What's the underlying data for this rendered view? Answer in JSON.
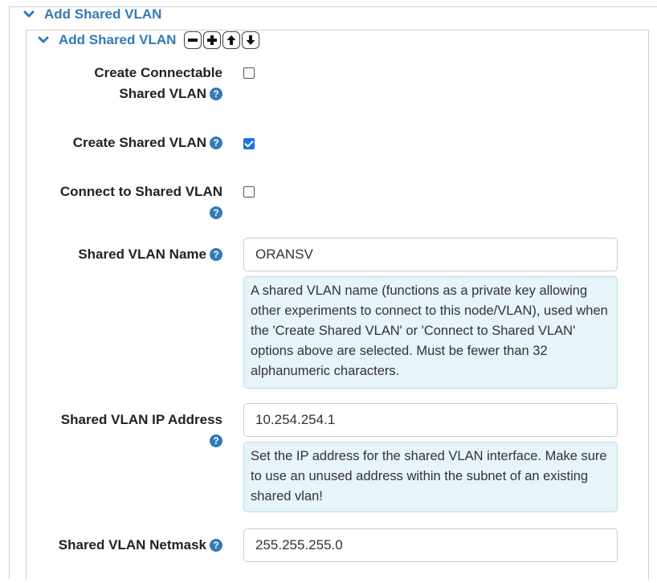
{
  "outer_section": {
    "title": "Add Shared VLAN"
  },
  "inner_section": {
    "title": "Add Shared VLAN"
  },
  "fields": {
    "create_connectable": {
      "label_line1": "Create Connectable",
      "label_line2": "Shared VLAN",
      "checked": false
    },
    "create_shared": {
      "label": "Create Shared VLAN",
      "checked": true
    },
    "connect_to_shared": {
      "label": "Connect to Shared VLAN",
      "checked": false
    },
    "shared_vlan_name": {
      "label": "Shared VLAN Name",
      "value": "ORANSV",
      "help": "A shared VLAN name (functions as a private key allowing other experiments to connect to this node/VLAN), used when the 'Create Shared VLAN' or 'Connect to Shared VLAN' options above are selected. Must be fewer than 32 alphanumeric characters."
    },
    "shared_vlan_ip": {
      "label": "Shared VLAN IP Address",
      "value": "10.254.254.1",
      "help": "Set the IP address for the shared VLAN interface. Make sure to use an unused address within the subnet of an existing shared vlan!"
    },
    "shared_vlan_netmask": {
      "label": "Shared VLAN Netmask",
      "value": "255.255.255.0"
    }
  },
  "icons": {
    "help_glyph": "?",
    "help_color": "#337ab7",
    "header_color": "#337ab7",
    "checkbox_checked_color": "#1a73e8",
    "note_background": "#e7f4fa"
  }
}
